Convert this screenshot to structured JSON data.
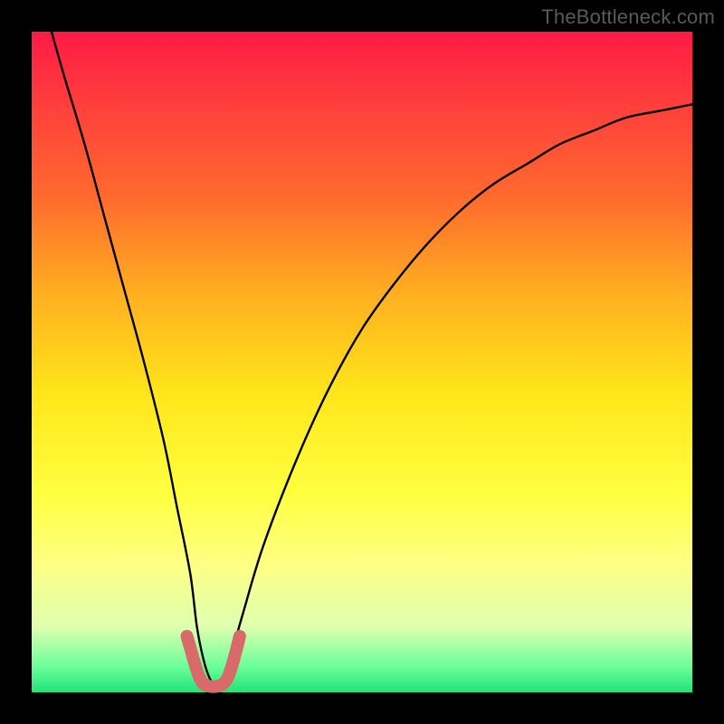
{
  "watermark": "TheBottleneck.com",
  "chart_data": {
    "type": "line",
    "title": "",
    "xlabel": "",
    "ylabel": "",
    "xlim": [
      0,
      100
    ],
    "ylim": [
      0,
      100
    ],
    "grid": false,
    "legend": false,
    "annotations": [],
    "series": [
      {
        "name": "bottleneck-curve",
        "color": "#000000",
        "x": [
          3,
          5,
          8,
          11,
          14,
          17,
          20,
          22,
          24,
          25,
          26,
          27,
          28,
          29,
          30,
          32,
          35,
          40,
          45,
          50,
          55,
          60,
          65,
          70,
          75,
          80,
          85,
          90,
          95,
          100
        ],
        "values": [
          100,
          93,
          83,
          72,
          61,
          50,
          38,
          28,
          18,
          10,
          5,
          2,
          1,
          2,
          5,
          12,
          22,
          35,
          46,
          55,
          62,
          68,
          73,
          77,
          80,
          83,
          85,
          87,
          88,
          89
        ]
      },
      {
        "name": "fit-overlay",
        "color": "#d86a6a",
        "x": [
          23.5,
          24.5,
          25.3,
          26.0,
          27.0,
          28.0,
          29.0,
          29.8,
          30.6,
          31.5
        ],
        "values": [
          8.5,
          5.0,
          2.5,
          1.3,
          0.9,
          0.9,
          1.3,
          2.5,
          5.0,
          8.5
        ]
      }
    ],
    "background_gradient": {
      "top": "#ff1a44",
      "mid": "#ffe61a",
      "bottom": "#21e37a"
    }
  }
}
